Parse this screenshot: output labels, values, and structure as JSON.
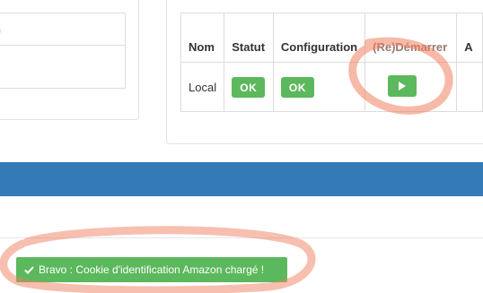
{
  "left_table": {
    "header": "n"
  },
  "right_table": {
    "headers": {
      "nom": "Nom",
      "statut": "Statut",
      "configuration": "Configuration",
      "start": "(Re)Démarrer",
      "extra": "A"
    },
    "row": {
      "nom": "Local",
      "statut": "OK",
      "configuration": "OK"
    }
  },
  "alert": {
    "message": "Bravo : Cookie d'identification Amazon chargé !"
  },
  "icons": {
    "play": "play-icon",
    "check": "check-icon"
  },
  "colors": {
    "success": "#5cb85c",
    "primary": "#337ab7",
    "annotation": "#f08060"
  }
}
